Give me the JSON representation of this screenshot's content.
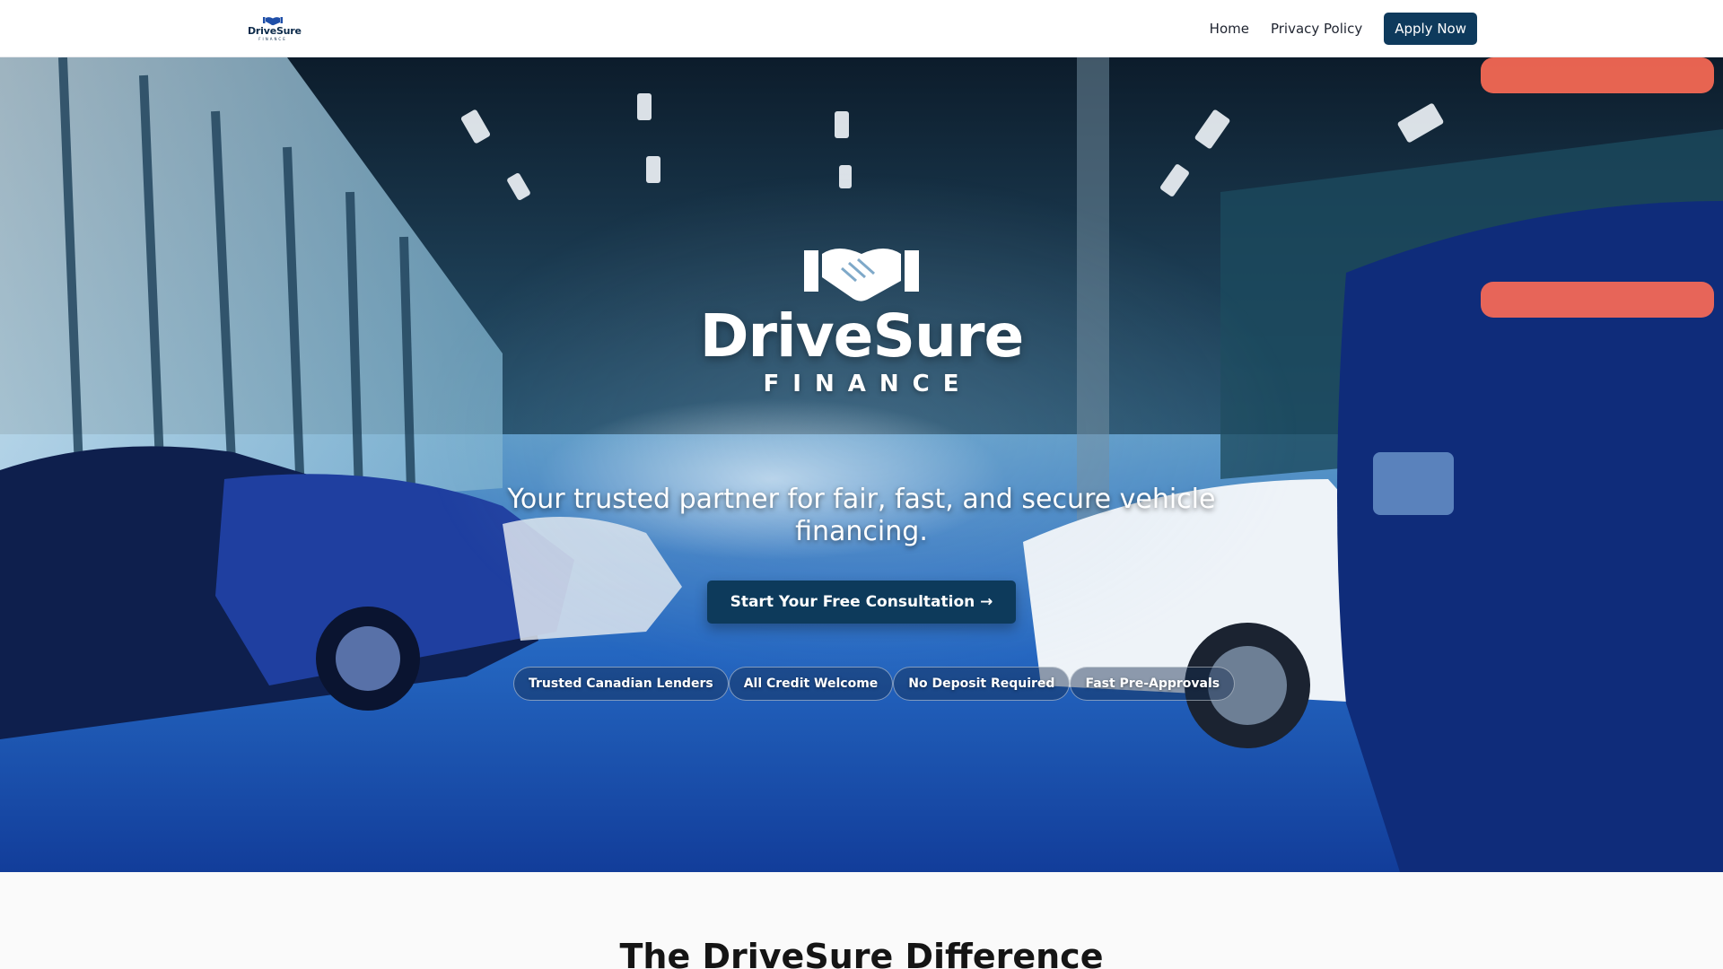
{
  "header": {
    "logo": {
      "word": "DriveSure",
      "sub": "FINANCE",
      "icon": "handshake-icon"
    },
    "nav": {
      "home": "Home",
      "privacy": "Privacy Policy",
      "apply": "Apply Now"
    }
  },
  "hero": {
    "brand": {
      "icon": "handshake-icon",
      "word": "DriveSure",
      "sub": "FINANCE"
    },
    "tagline": "Your trusted partner for fair, fast, and secure vehicle financing.",
    "cta": "Start Your Free Consultation →",
    "badges": [
      "Trusted Canadian Lenders",
      "All Credit Welcome",
      "No Deposit Required",
      "Fast Pre-Approvals"
    ],
    "background": "car-showroom-photo"
  },
  "sections": {
    "difference_title": "The DriveSure Difference"
  },
  "colors": {
    "primary": "#0e3a5c",
    "text": "#1f2430",
    "white": "#ffffff",
    "hero_blue": "#1d5fb4"
  }
}
